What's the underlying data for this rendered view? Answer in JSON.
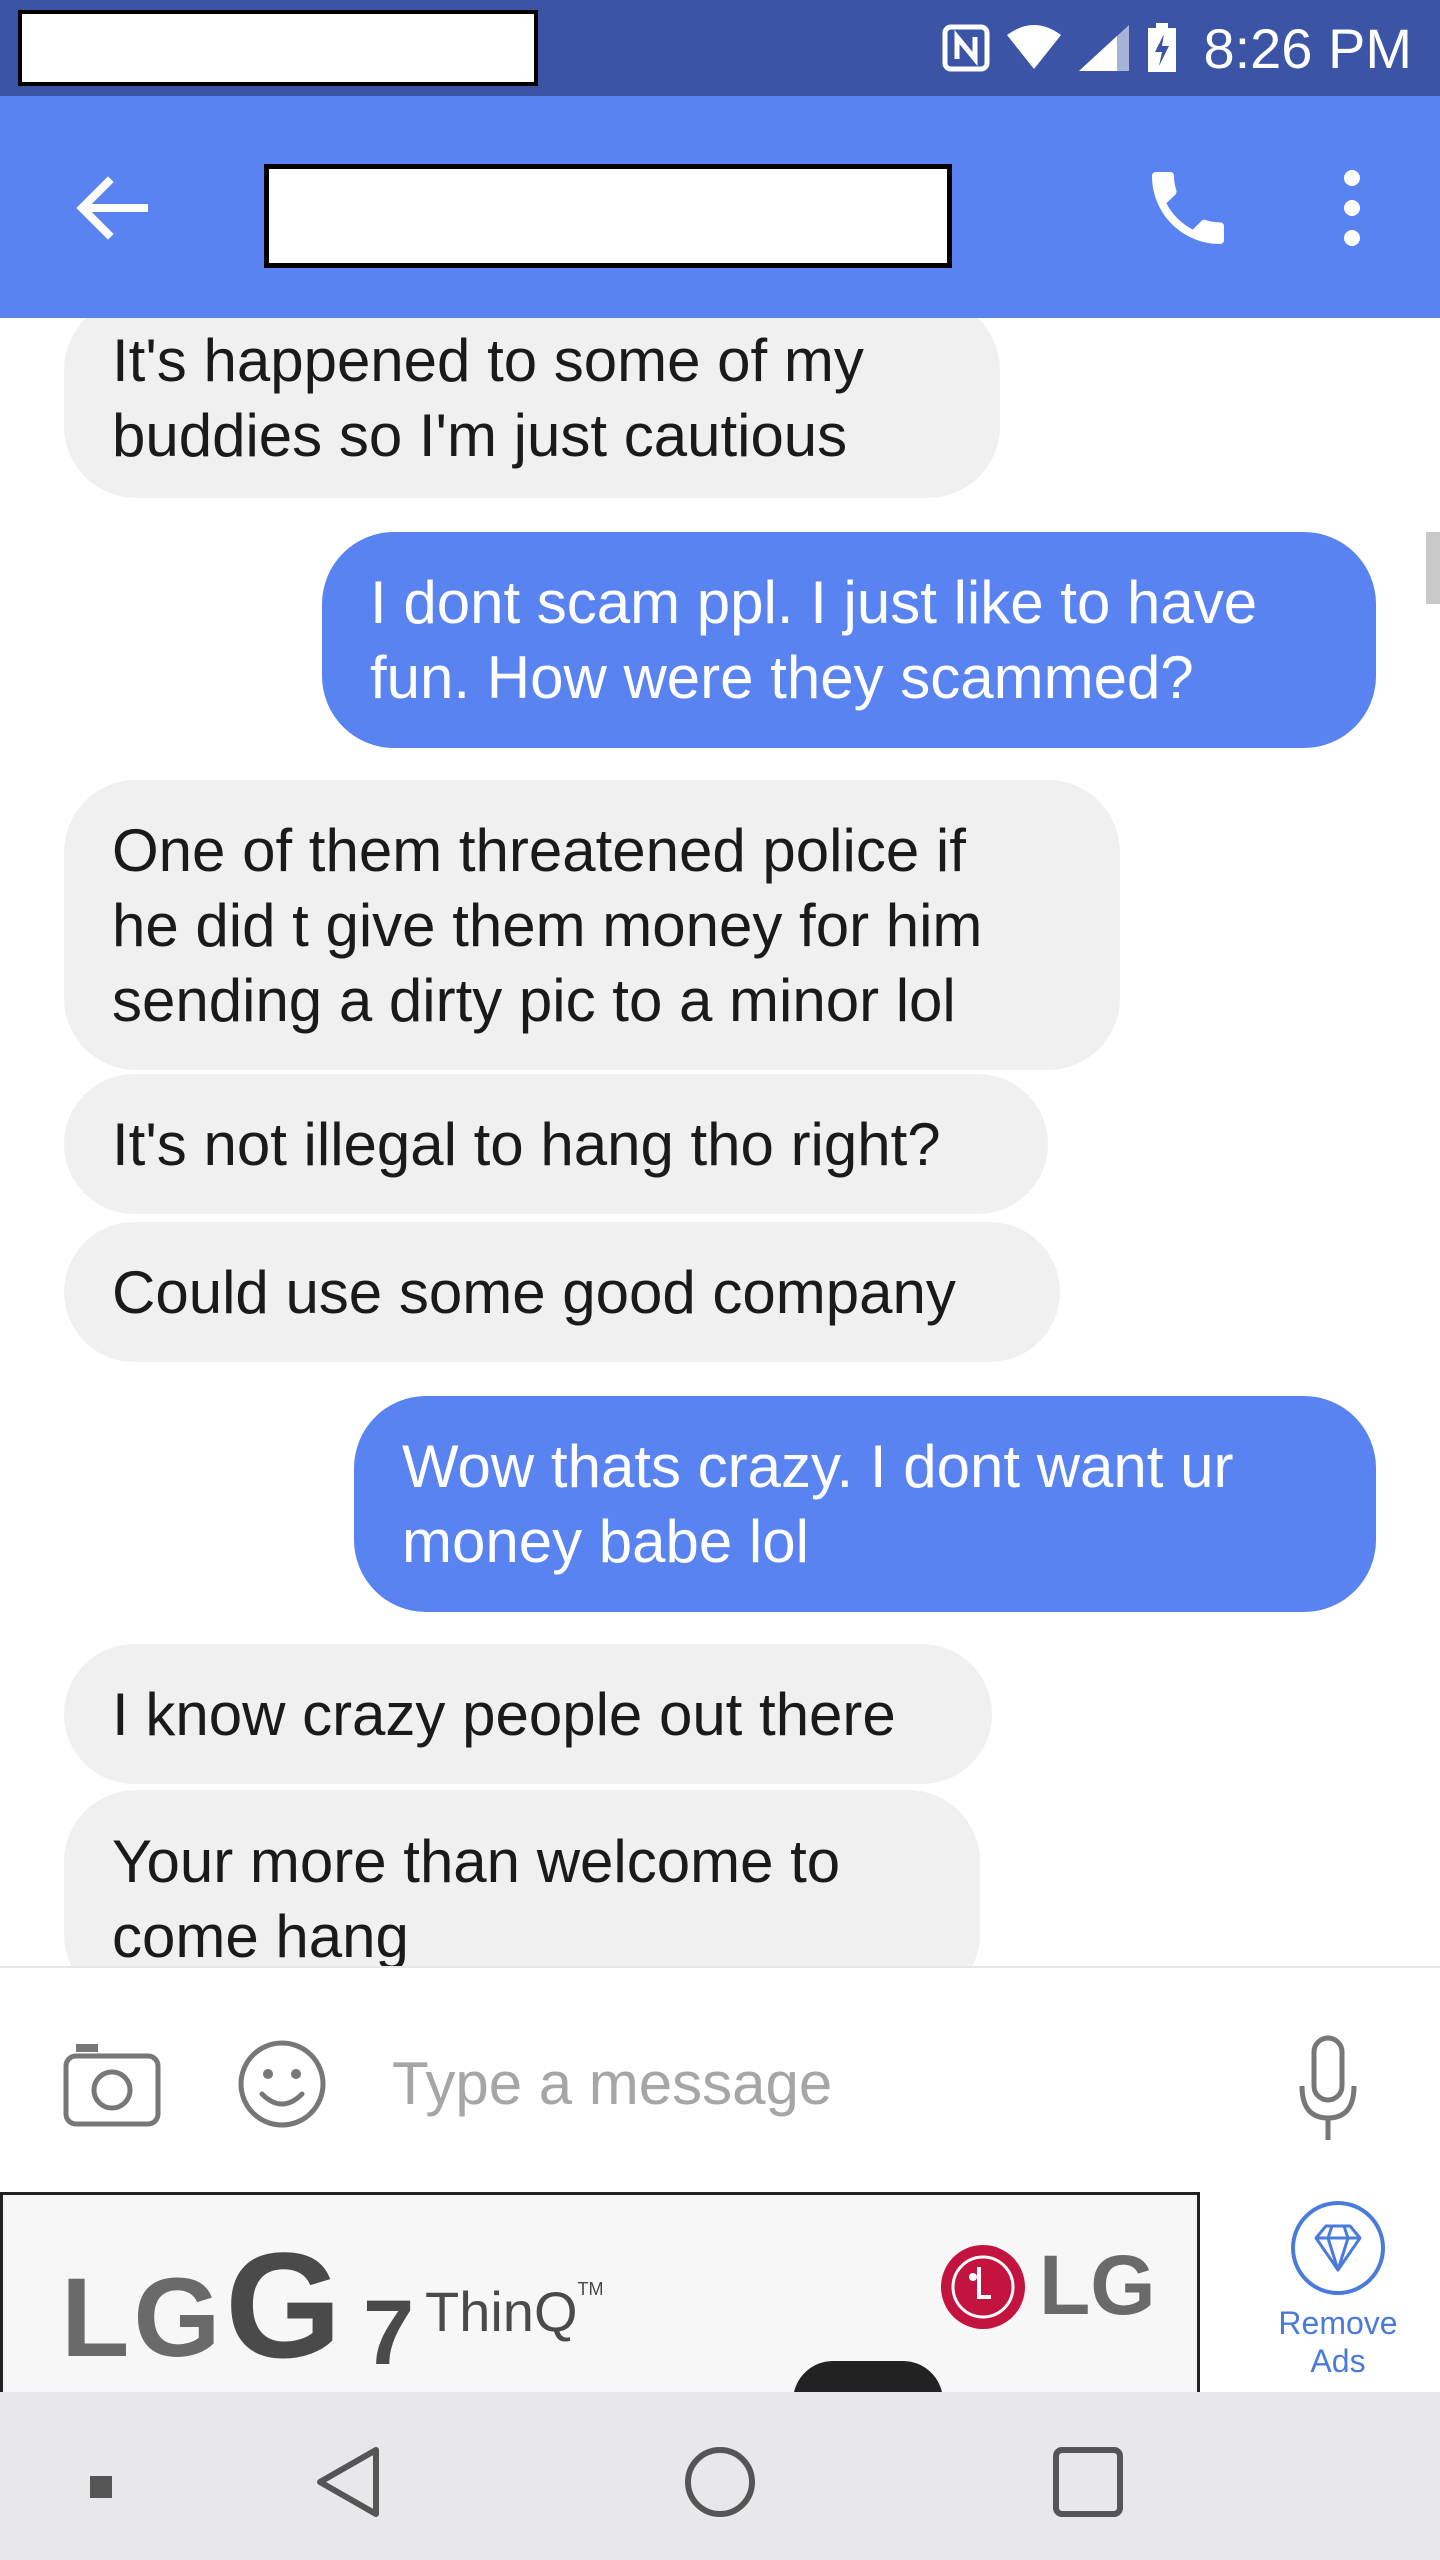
{
  "status_bar": {
    "time": "8:26 PM"
  },
  "toolbar": {},
  "messages": [
    {
      "dir": "in",
      "text": "It's happened to some of my\nbuddies so I'm just cautious"
    },
    {
      "dir": "out",
      "text": "I dont scam ppl. I just like to have\nfun. How were they scammed?"
    },
    {
      "dir": "in",
      "text": "One of them threatened police if\nhe did t give them money for him\nsending a dirty pic to a minor lol"
    },
    {
      "dir": "in",
      "text": "It's not illegal to hang tho right?"
    },
    {
      "dir": "in",
      "text": "Could use some good company"
    },
    {
      "dir": "out",
      "text": "Wow thats crazy. I dont want ur\nmoney babe lol"
    },
    {
      "dir": "in",
      "text": "I know crazy people out there"
    },
    {
      "dir": "in",
      "text": "Your more than welcome to\ncome hang"
    }
  ],
  "composer": {
    "placeholder": "Type a message"
  },
  "ad": {
    "brand_left": "LG",
    "product_g": "G",
    "product_num": "7",
    "product_name": "ThinQ",
    "tm": "TM",
    "brand_right": "LG",
    "remove_ads_label": "Remove\nAds"
  },
  "colors": {
    "status_bar": "#3b54a6",
    "toolbar": "#5883f0",
    "outgoing_bubble": "#5883f0",
    "incoming_bubble": "#f0f0f0",
    "lg_red": "#c3133f"
  },
  "icons": {
    "back": "arrow-left-icon",
    "call": "phone-icon",
    "more": "more-vert-icon",
    "camera": "camera-icon",
    "emoji": "emoji-icon",
    "mic": "microphone-icon",
    "remove_ads": "diamond-icon"
  }
}
